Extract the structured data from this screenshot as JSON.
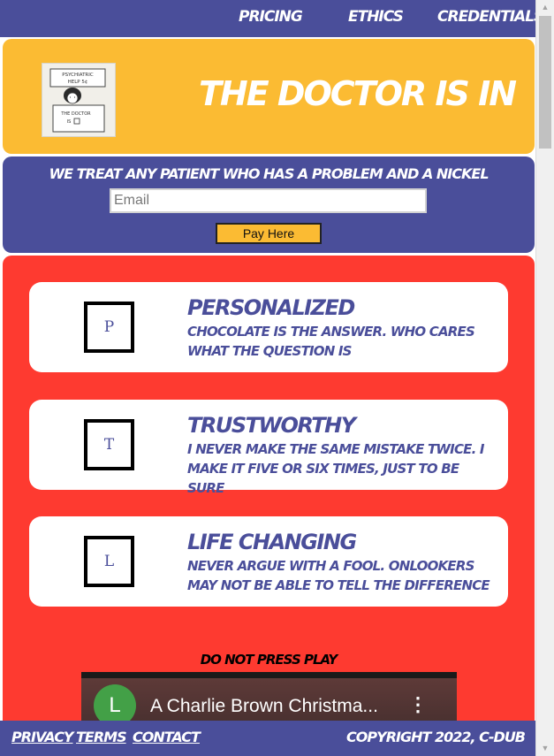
{
  "nav": {
    "items": [
      "PRICING",
      "ETHICS",
      "CREDENTIALS"
    ]
  },
  "header": {
    "title": "THE DOCTOR IS IN",
    "logo_lines": [
      "PSYCHIATRIC",
      "HELP 5¢",
      "THE DOCTOR",
      "IS"
    ]
  },
  "signup": {
    "tagline": "WE TREAT ANY PATIENT WHO HAS A PROBLEM AND A NICKEL",
    "email_placeholder": "Email",
    "button_label": "Pay Here"
  },
  "features": [
    {
      "icon_letter": "P",
      "title": "PERSONALIZED",
      "text": "CHOCOLATE IS THE ANSWER. WHO CARES WHAT THE QUESTION IS"
    },
    {
      "icon_letter": "T",
      "title": "TRUSTWORTHY",
      "text": "I NEVER MAKE THE SAME MISTAKE TWICE. I MAKE IT FIVE OR SIX TIMES, JUST TO BE SURE"
    },
    {
      "icon_letter": "L",
      "title": "LIFE CHANGING",
      "text": "NEVER ARGUE WITH A FOOL. ONLOOKERS MAY NOT BE ABLE TO TELL THE DIFFERENCE"
    }
  ],
  "video": {
    "label": "DO NOT PRESS PLAY",
    "channel_initial": "L",
    "title": "A Charlie Brown Christma..."
  },
  "footer": {
    "links": [
      "PRIVACY",
      "TERMS",
      "CONTACT"
    ],
    "copyright": "COPYRIGHT 2022, C-DUB"
  },
  "colors": {
    "nav": "#4a4e9a",
    "header": "#fbbb33",
    "features": "#fe3a30",
    "card_text": "#4a4e9a",
    "avatar": "#43a047"
  }
}
